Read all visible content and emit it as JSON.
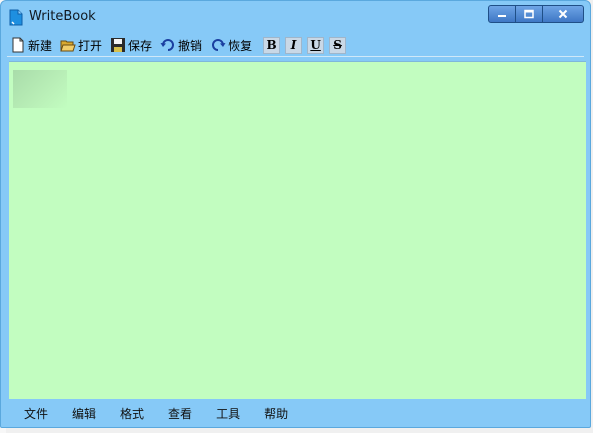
{
  "window": {
    "title": "WriteBook"
  },
  "toolbar": {
    "new_label": "新建",
    "open_label": "打开",
    "save_label": "保存",
    "undo_label": "撤销",
    "redo_label": "恢复",
    "bold_label": "B",
    "italic_label": "I",
    "underline_label": "U",
    "strike_label": "S"
  },
  "menu": {
    "items": [
      "文件",
      "编辑",
      "格式",
      "查看",
      "工具",
      "帮助"
    ]
  },
  "colors": {
    "window_bg": "#86c9f7",
    "editor_bg": "#c2fdc0"
  }
}
